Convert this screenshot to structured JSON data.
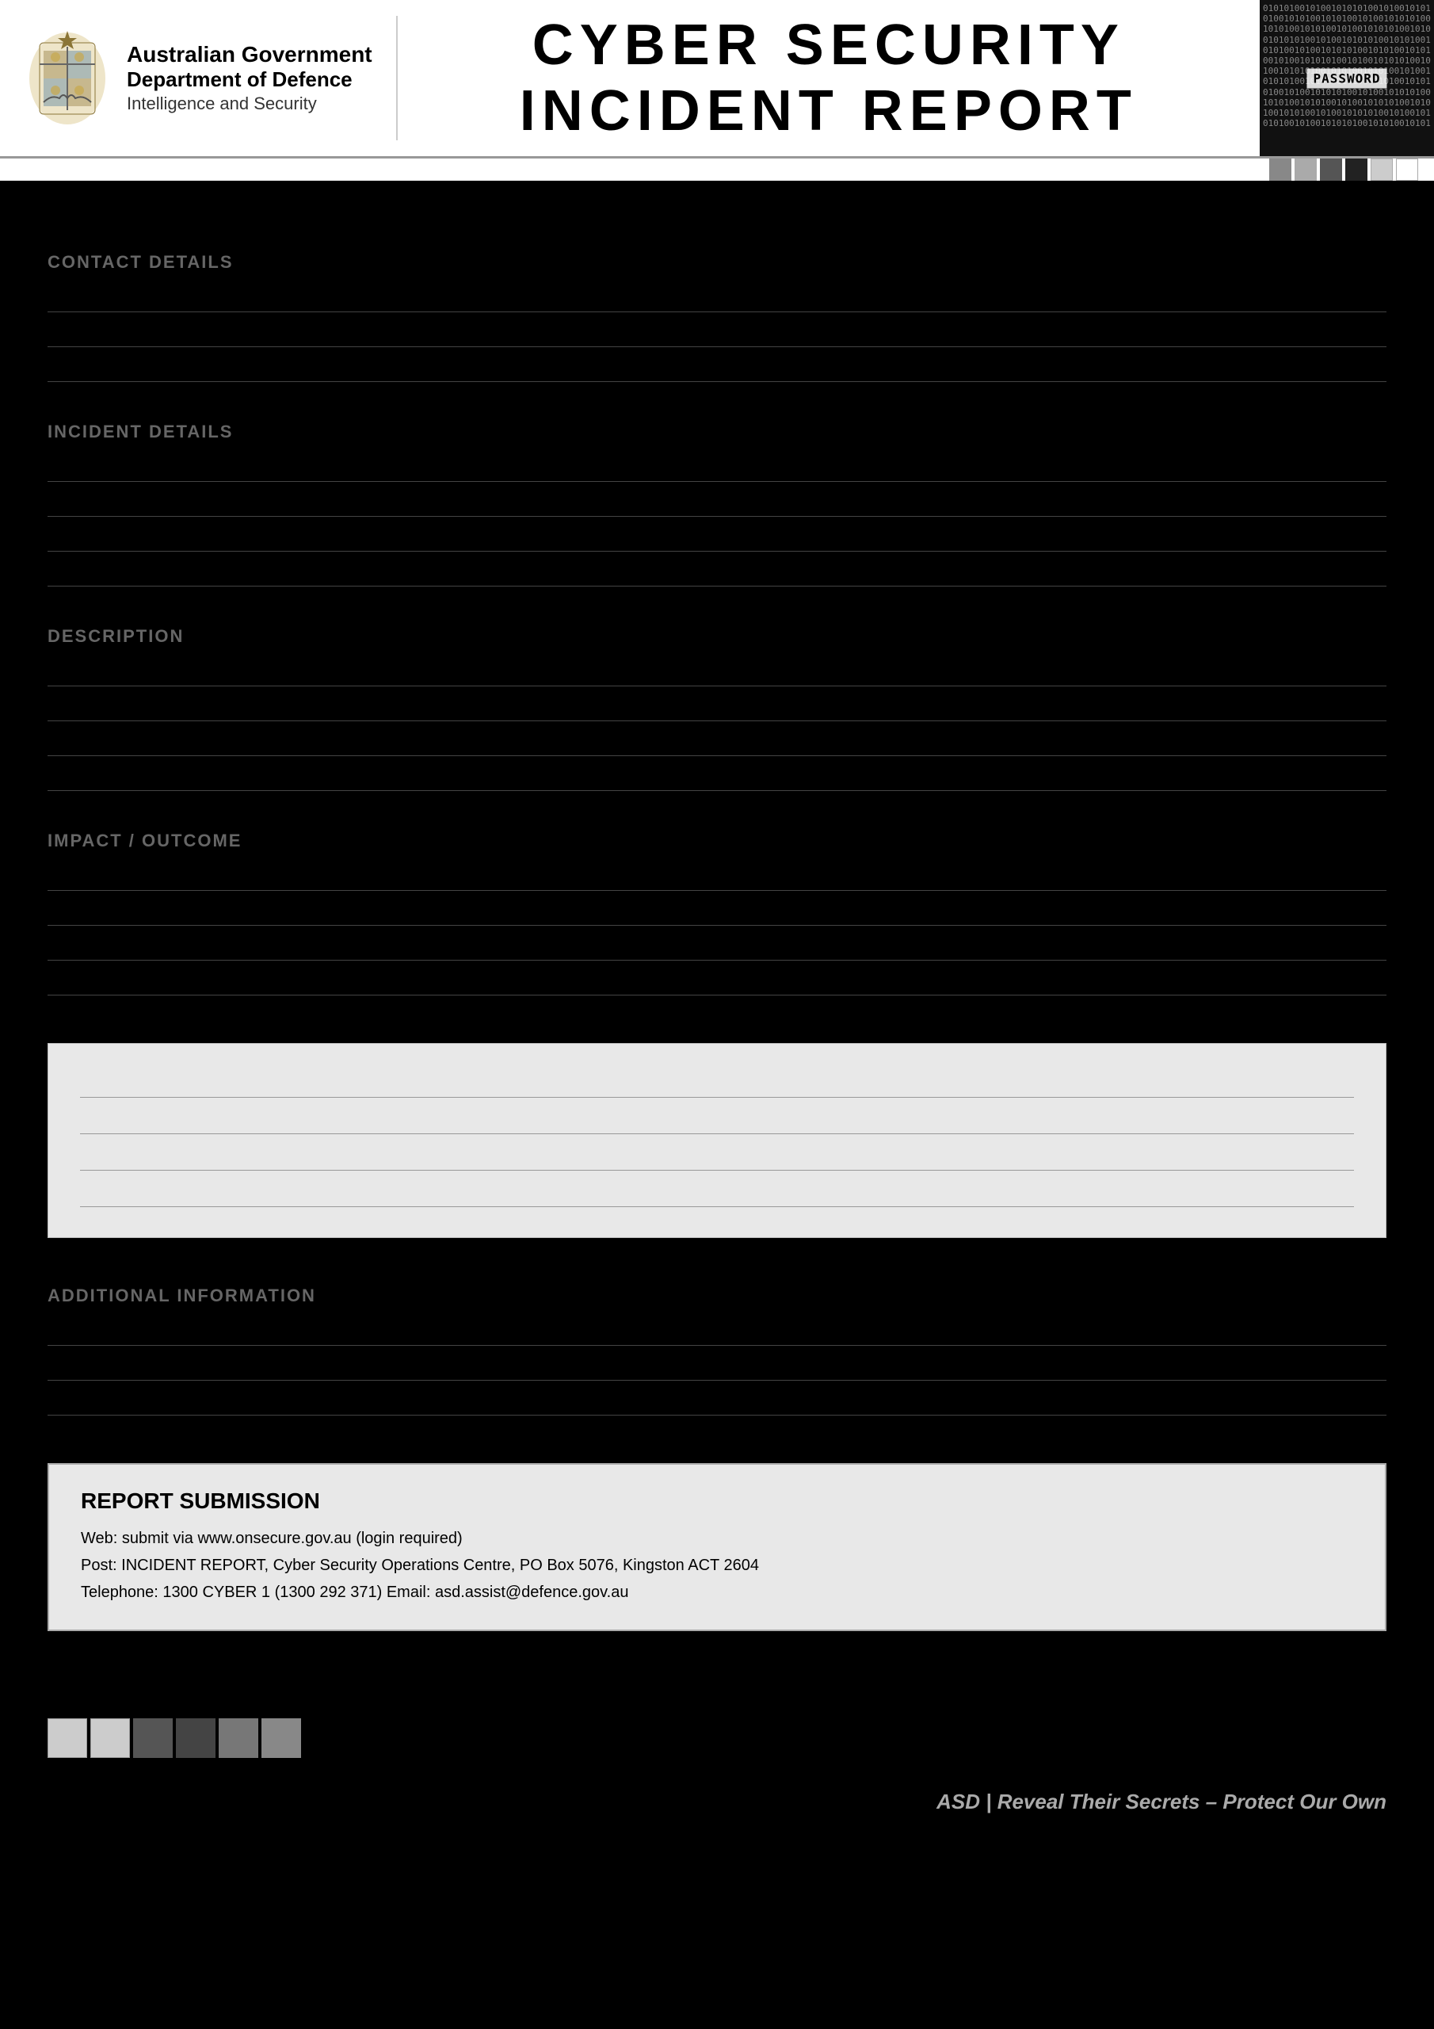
{
  "header": {
    "gov_line1": "Australian Government",
    "gov_line2": "Department of Defence",
    "gov_line3": "Intelligence and Security",
    "title_line1": "CYBER SECURITY",
    "title_line2": "INCIDENT REPORT"
  },
  "color_bar": {
    "squares": [
      {
        "color": "#888888"
      },
      {
        "color": "#aaaaaa"
      },
      {
        "color": "#555555"
      },
      {
        "color": "#222222"
      },
      {
        "color": "#cccccc"
      },
      {
        "color": "#ffffff"
      }
    ]
  },
  "form": {
    "sections": [
      {
        "id": "contact",
        "label": "CONTACT DETAILS",
        "lines": 3
      },
      {
        "id": "incident",
        "label": "INCIDENT DETAILS",
        "lines": 4
      },
      {
        "id": "description",
        "label": "DESCRIPTION",
        "lines": 4
      },
      {
        "id": "impact",
        "label": "IMPACT / OUTCOME",
        "lines": 4
      },
      {
        "id": "additional",
        "label": "ADDITIONAL INFORMATION",
        "lines": 3
      }
    ]
  },
  "gray_box": {
    "lines": 4
  },
  "report_submission": {
    "heading": "REPORT SUBMISSION",
    "line1": "Web: submit via www.onsecure.gov.au (login required)",
    "line2": "Post: INCIDENT REPORT, Cyber Security Operations Centre, PO Box 5076, Kingston ACT 2604",
    "line3": "Telephone: 1300 CYBER 1 (1300 292 371)  Email: asd.assist@defence.gov.au"
  },
  "bottom_squares": [
    {
      "color": "#cccccc"
    },
    {
      "color": "#888888"
    },
    {
      "color": "#444444"
    },
    {
      "color": "#666666"
    },
    {
      "color": "#999999"
    },
    {
      "color": "#555555"
    }
  ],
  "footer_tagline": "ASD | Reveal Their Secrets – Protect Our Own",
  "binary_text": "010101001010010101010010100101010100101010010101001010010101010010101001010100101001010101001010010101010010100101010100101010010101001010010101010010101001010100101001010101001010010101010010100101010100101010010101001010010101010010101001010100101001010101001010010101010010100101010100101010010101001010010101010010101001010100101001010101001010010101010010100101010100101010010101"
}
